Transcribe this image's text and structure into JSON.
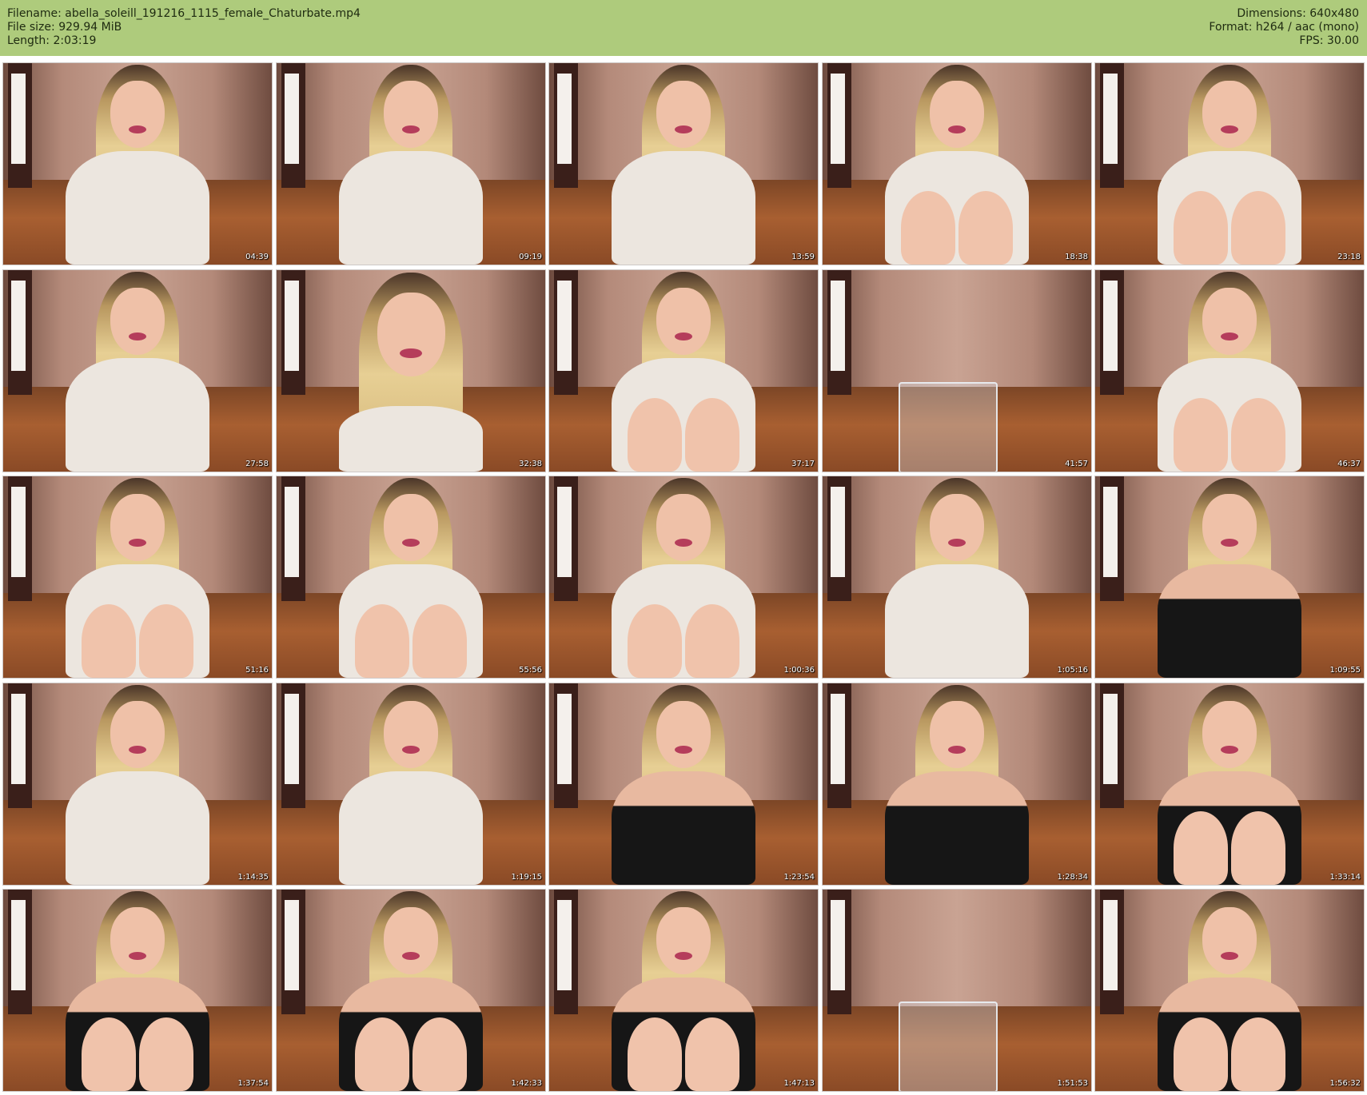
{
  "header": {
    "filename": "Filename: abella_soleill_191216_1115_female_Chaturbate.mp4",
    "filesize": "File size: 929.94 MiB",
    "length": "Length: 2:03:19",
    "dimensions": "Dimensions: 640x480",
    "format": "Format: h264 / aac (mono)",
    "fps": "FPS: 30.00"
  },
  "colors": {
    "header_background": "#aecb7c",
    "page_background": "#ffffff",
    "timestamp_text": "#ffffff"
  },
  "thumbnails": [
    {
      "timestamp": "04:39",
      "scene": "sweater"
    },
    {
      "timestamp": "09:19",
      "scene": "sweater"
    },
    {
      "timestamp": "13:59",
      "scene": "sweater"
    },
    {
      "timestamp": "18:38",
      "scene": "sweater-knees"
    },
    {
      "timestamp": "23:18",
      "scene": "sweater-knees"
    },
    {
      "timestamp": "27:58",
      "scene": "sweater-phone"
    },
    {
      "timestamp": "32:38",
      "scene": "sweater-closeup"
    },
    {
      "timestamp": "37:17",
      "scene": "sweater-knees"
    },
    {
      "timestamp": "41:57",
      "scene": "empty-chair"
    },
    {
      "timestamp": "46:37",
      "scene": "sweater-knees"
    },
    {
      "timestamp": "51:16",
      "scene": "sweater-knees"
    },
    {
      "timestamp": "55:56",
      "scene": "sweater-knees"
    },
    {
      "timestamp": "1:00:36",
      "scene": "sweater-knees"
    },
    {
      "timestamp": "1:05:16",
      "scene": "sweater"
    },
    {
      "timestamp": "1:09:55",
      "scene": "standing"
    },
    {
      "timestamp": "1:14:35",
      "scene": "sweater"
    },
    {
      "timestamp": "1:19:15",
      "scene": "sweater"
    },
    {
      "timestamp": "1:23:54",
      "scene": "black-top"
    },
    {
      "timestamp": "1:28:34",
      "scene": "black-top"
    },
    {
      "timestamp": "1:33:14",
      "scene": "black-top-knees"
    },
    {
      "timestamp": "1:37:54",
      "scene": "black-top-knees"
    },
    {
      "timestamp": "1:42:33",
      "scene": "black-top-knees"
    },
    {
      "timestamp": "1:47:13",
      "scene": "black-top-knees"
    },
    {
      "timestamp": "1:51:53",
      "scene": "empty-chair"
    },
    {
      "timestamp": "1:56:32",
      "scene": "black-top-knees"
    }
  ]
}
